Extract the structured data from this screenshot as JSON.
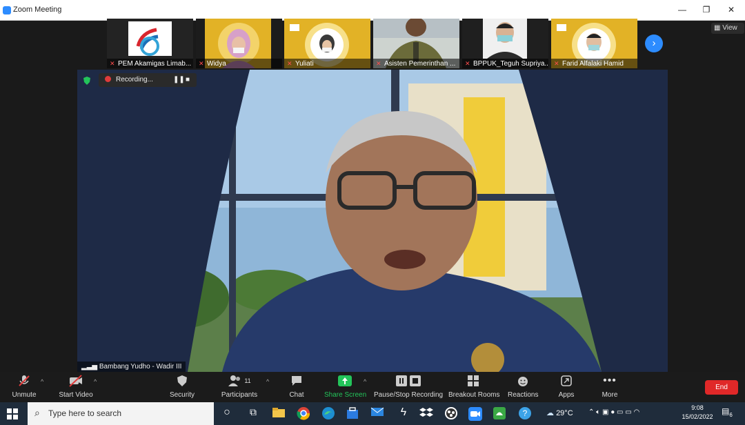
{
  "window": {
    "title": "Zoom Meeting",
    "minimize": "—",
    "restore": "❐",
    "close": "✕"
  },
  "view_button": {
    "label": "View"
  },
  "participants_strip": [
    {
      "name": "PEM Akamigas Limab..."
    },
    {
      "name": "Widya"
    },
    {
      "name": "Yuliati"
    },
    {
      "name": "Asisten Pemerinthan ..."
    },
    {
      "name": "BPPUK_Teguh Supriya..."
    },
    {
      "name": "Farid Alfalaki Hamid"
    }
  ],
  "recording": {
    "label": "Recording..."
  },
  "active_speaker": {
    "name": "Bambang Yudho - Wadir III"
  },
  "toolbar": {
    "unmute": "Unmute",
    "start_video": "Start Video",
    "security": "Security",
    "participants": "Participants",
    "participant_count": "11",
    "chat": "Chat",
    "share_screen": "Share Screen",
    "pause_recording": "Pause/Stop Recording",
    "breakout_rooms": "Breakout Rooms",
    "reactions": "Reactions",
    "apps": "Apps",
    "more": "More",
    "end": "End"
  },
  "taskbar": {
    "search_placeholder": "Type here to search",
    "temperature": "29°C",
    "time": "9:08",
    "date": "15/02/2022",
    "notification_count": "6"
  },
  "colors": {
    "accent": "#2d8cff",
    "end": "#e02828",
    "share": "#23c45a"
  }
}
